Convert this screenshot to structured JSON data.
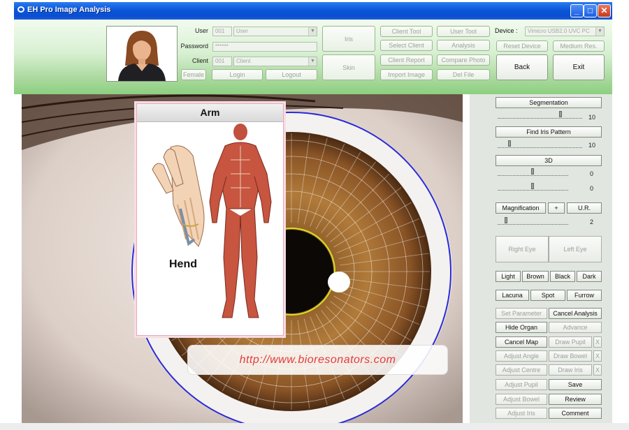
{
  "window": {
    "title": "EH Pro Image Analysis",
    "controls": {
      "minimize": "_",
      "maximize": "□",
      "close": "✕"
    }
  },
  "header": {
    "user_label": "User",
    "user_code": "001",
    "user_value": "User",
    "password_label": "Password",
    "password_value": "******",
    "client_label": "Client",
    "client_code": "001",
    "client_value": "Client",
    "gender": "Female",
    "login": "Login",
    "logout": "Logout",
    "iris": "Iris",
    "skin": "Skin",
    "client_tool": "Client Tool",
    "select_client": "Select Client",
    "client_report": "Client Report",
    "import_image": "Import Image",
    "user_tool": "User Tool",
    "analysis": "Analysis",
    "compare_photo": "Compare Photo",
    "del_file": "Del File",
    "device_label": "Device :",
    "device_value": "Vimicro USB2.0 UVC PC",
    "reset_device": "Reset Device",
    "resolution": "Medium Res.",
    "back": "Back",
    "exit": "Exit"
  },
  "diagram": {
    "title": "Arm",
    "hand_label": "Hend"
  },
  "watermark": "http://www.bioresonators.com",
  "panel": {
    "segmentation": "Segmentation",
    "segmentation_value": "10",
    "find_iris_pattern": "Find Iris Pattern",
    "find_iris_value": "10",
    "three_d": "3D",
    "three_d_value_1": "0",
    "three_d_value_2": "0",
    "magnification": "Magnification",
    "plus": "+",
    "ur": "U.R.",
    "magnification_value": "2",
    "right_eye": "Right Eye",
    "left_eye": "Left Eye",
    "colors": [
      "Light",
      "Brown",
      "Black",
      "Dark"
    ],
    "marks": [
      "Lacuna",
      "Spot",
      "Furrow"
    ],
    "set_parameter": "Set Parameter",
    "cancel_analysis": "Cancel Analysis",
    "hide_organ": "Hide Organ",
    "advance": "Advance",
    "cancel_map": "Cancel Map",
    "draw_pupil": "Draw Pupil",
    "adjust_angle": "Adjust Angle",
    "draw_bowel": "Draw Bowel",
    "adjust_centre": "Adjust Centre",
    "draw_iris": "Draw Iris",
    "adjust_pupil": "Adjust Pupil",
    "save": "Save",
    "adjust_bowel": "Adjust Bowel",
    "review": "Review",
    "adjust_iris": "Adjust Iris",
    "comment": "Comment",
    "x": "X"
  }
}
